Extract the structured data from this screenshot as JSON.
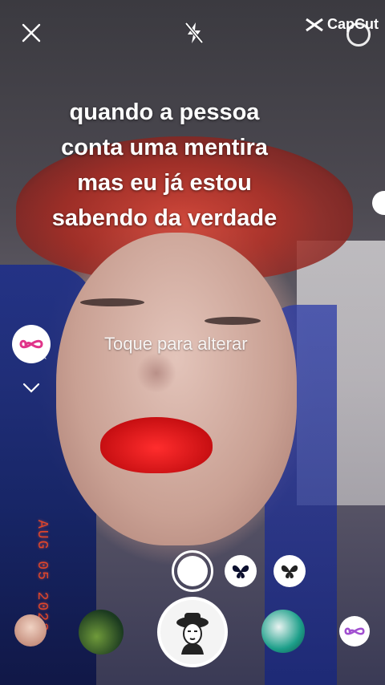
{
  "header": {
    "close_icon": "close-icon",
    "flash_icon": "flash-off-icon",
    "brand_name": "CapCut",
    "flip_icon": "flip-camera-icon"
  },
  "caption": {
    "lines": [
      "quando a pessoa",
      "conta uma mentira",
      "mas eu já estou",
      "sabendo da verdade"
    ]
  },
  "hint": "Toque para alterar",
  "side_effect": {
    "icon": "infinity-icon",
    "remove_label": "×"
  },
  "date_stamp": "AUG 05 2023",
  "controls": {
    "shutter_icon": "record-button",
    "effects": [
      "butterfly-icon",
      "butterfly-icon"
    ]
  },
  "colors": {
    "date": "#e2462a",
    "accent": "#ffffff"
  }
}
